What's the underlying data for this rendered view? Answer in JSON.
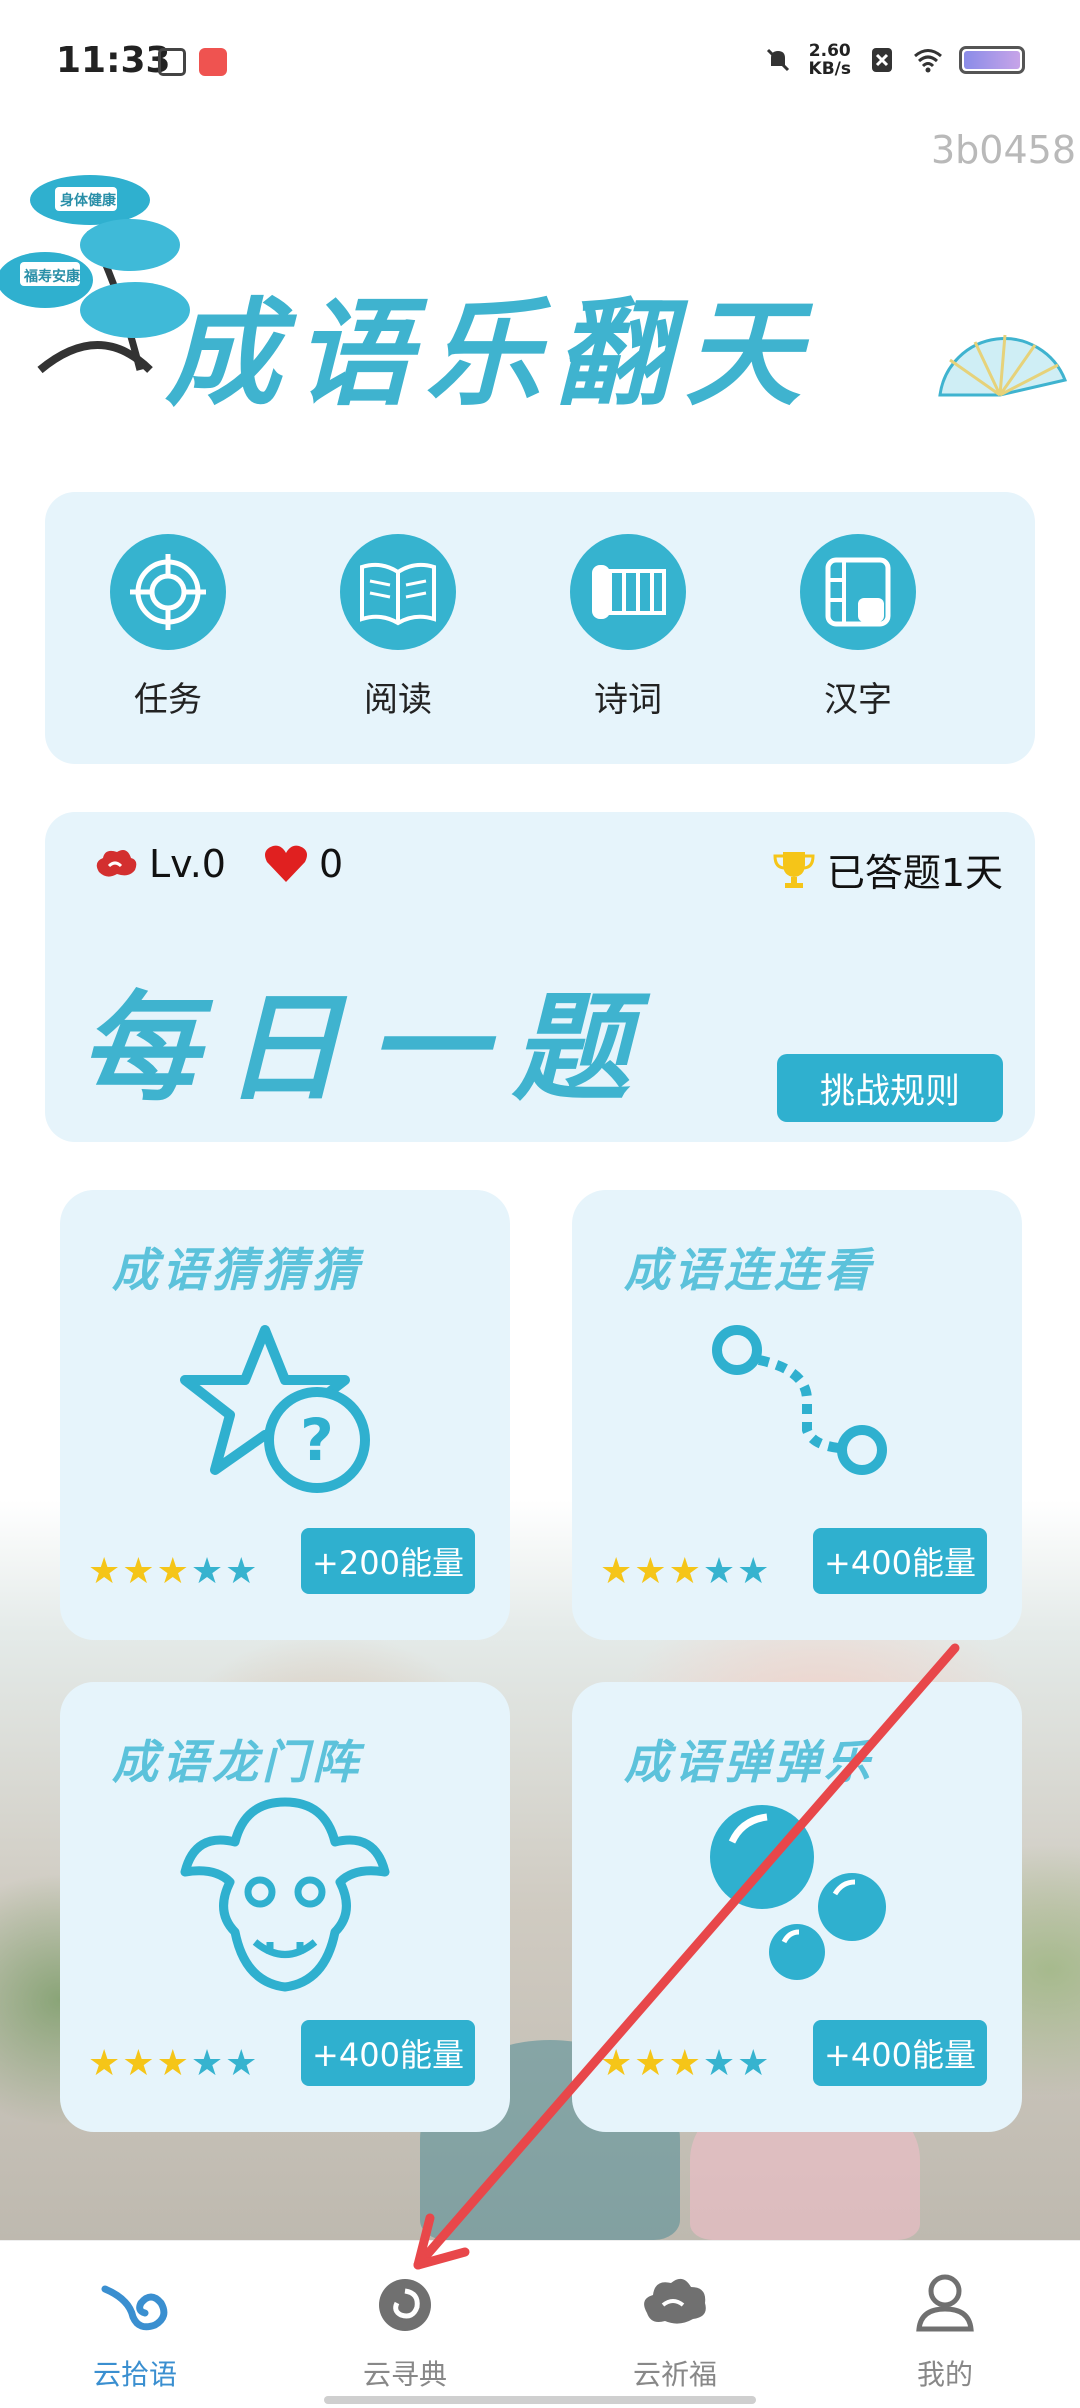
{
  "status_bar": {
    "time": "11:33",
    "net_speed_value": "2.60",
    "net_speed_unit": "KB/s"
  },
  "device_code": "3b0458",
  "app_title": "成语乐翻天",
  "banner_tags": [
    "身体健康",
    "福寿安康"
  ],
  "quick_nav": [
    {
      "label": "任务",
      "icon": "target-icon"
    },
    {
      "label": "阅读",
      "icon": "open-book-icon"
    },
    {
      "label": "诗词",
      "icon": "scroll-icon"
    },
    {
      "label": "汉字",
      "icon": "character-book-icon"
    }
  ],
  "daily": {
    "level": "Lv.0",
    "hearts": "0",
    "answered": "已答题1天",
    "title": "每日一题",
    "rules_button": "挑战规则"
  },
  "games": [
    {
      "title": "成语猜猜猜",
      "stars_on": 3,
      "stars_total": 5,
      "energy": "+200能量",
      "icon": "star-question-icon"
    },
    {
      "title": "成语连连看",
      "stars_on": 3,
      "stars_total": 5,
      "energy": "+400能量",
      "icon": "connect-path-icon"
    },
    {
      "title": "成语龙门阵",
      "stars_on": 3,
      "stars_total": 5,
      "energy": "+400能量",
      "icon": "dragon-icon"
    },
    {
      "title": "成语弹弹乐",
      "stars_on": 3,
      "stars_total": 5,
      "energy": "+400能量",
      "icon": "bubbles-icon"
    }
  ],
  "tabs": [
    {
      "label": "云拾语",
      "active": true
    },
    {
      "label": "云寻典",
      "active": false
    },
    {
      "label": "云祈福",
      "active": false
    },
    {
      "label": "我的",
      "active": false
    }
  ],
  "colors": {
    "accent": "#36b3cf",
    "card_bg": "#e6f4fb",
    "star": "#f5c518",
    "annotation": "#e8474a"
  }
}
